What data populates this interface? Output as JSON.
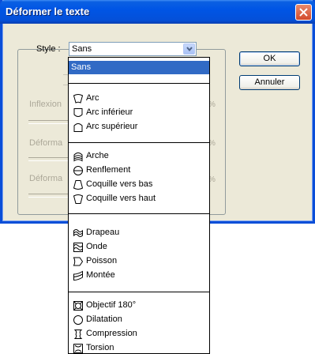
{
  "dialog": {
    "title": "Déformer le texte",
    "style_label": "Style :",
    "style_value": "Sans",
    "ok_label": "OK",
    "cancel_label": "Annuler",
    "inflexion_label": "Inflexion",
    "deform_h_label": "Déforma",
    "deform_v_label": "Déforma",
    "percent": "%"
  },
  "dropdown": {
    "selected": "Sans",
    "groups": [
      {
        "items": [
          {
            "label": "Sans",
            "icon": "none-icon"
          }
        ]
      },
      {
        "items": []
      },
      {
        "items": [
          {
            "label": "Arc",
            "icon": "arc-icon"
          },
          {
            "label": "Arc inférieur",
            "icon": "arc-lower-icon"
          },
          {
            "label": "Arc supérieur",
            "icon": "arc-upper-icon"
          }
        ]
      },
      {
        "items": [
          {
            "label": "Arche",
            "icon": "arch-icon"
          },
          {
            "label": "Renflement",
            "icon": "bulge-icon"
          },
          {
            "label": "Coquille vers bas",
            "icon": "shell-lower-icon"
          },
          {
            "label": "Coquille vers haut",
            "icon": "shell-upper-icon"
          }
        ]
      },
      {
        "items": [
          {
            "label": "Drapeau",
            "icon": "flag-icon"
          },
          {
            "label": "Onde",
            "icon": "wave-icon"
          },
          {
            "label": "Poisson",
            "icon": "fish-icon"
          },
          {
            "label": "Montée",
            "icon": "rise-icon"
          }
        ]
      },
      {
        "items": [
          {
            "label": "Objectif 180°",
            "icon": "fisheye-icon"
          },
          {
            "label": "Dilatation",
            "icon": "inflate-icon"
          },
          {
            "label": "Compression",
            "icon": "squeeze-icon"
          },
          {
            "label": "Torsion",
            "icon": "twist-icon"
          }
        ]
      }
    ]
  },
  "colors": {
    "titlebar": "#0055e5",
    "selection": "#316ac5",
    "dialog_bg": "#ece9d8"
  }
}
